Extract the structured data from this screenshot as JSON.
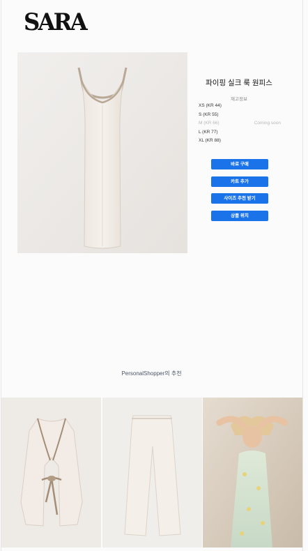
{
  "brand": {
    "logo_text": "SARA"
  },
  "product": {
    "title": "파이핑 실크 룩 원피스",
    "stock_link": "재고정보",
    "image_icon": "slip-dress-image"
  },
  "sizes": [
    {
      "label": "XS (KR 44)",
      "status": "",
      "available": true
    },
    {
      "label": "S (KR 55)",
      "status": "",
      "available": true
    },
    {
      "label": "M (KR 66)",
      "status": "Coming soon",
      "available": false
    },
    {
      "label": "L (KR 77)",
      "status": "",
      "available": true
    },
    {
      "label": "XL (KR 88)",
      "status": "",
      "available": true
    }
  ],
  "actions": {
    "buy_now": "바로 구매",
    "add_to_cart": "카트 추가",
    "size_recommend": "사이즈 추천 받기",
    "product_location": "상품 위치"
  },
  "recommendations": {
    "title": "PersonalShopper의 추천",
    "items": [
      {
        "icon": "tie-belt-jacket-image"
      },
      {
        "icon": "wide-trousers-image"
      },
      {
        "icon": "floral-slip-dress-model-image"
      }
    ]
  },
  "colors": {
    "accent": "#1a73e8",
    "text_muted": "#888888",
    "background": "#fbfbfc"
  }
}
